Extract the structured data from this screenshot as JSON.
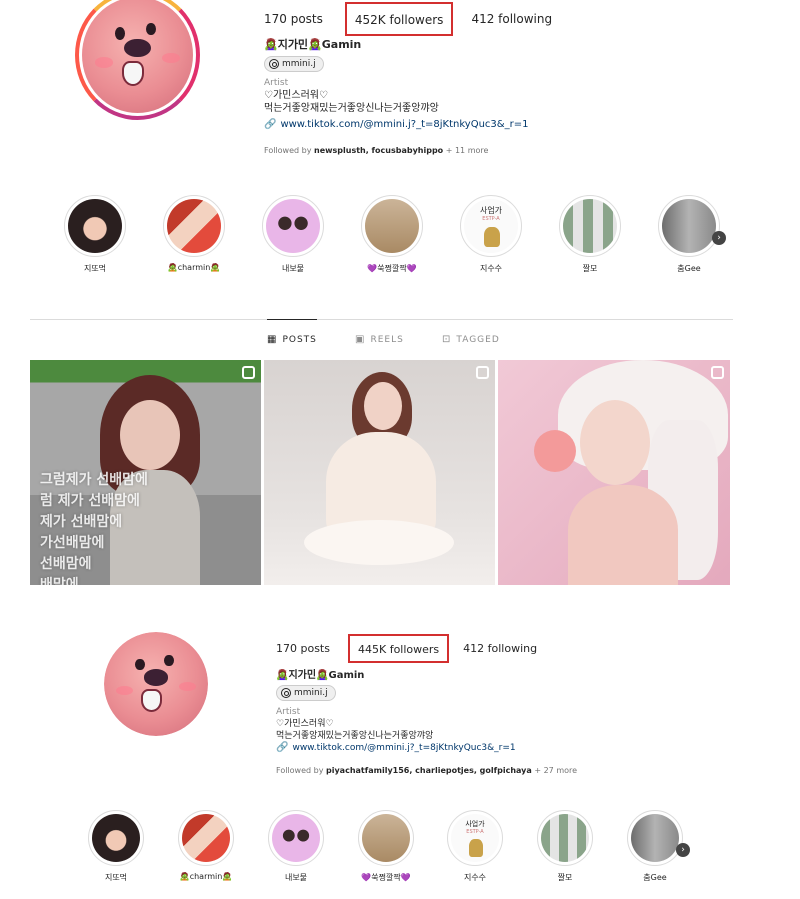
{
  "profile_top": {
    "stats": {
      "posts": "170 posts",
      "followers": "452K followers",
      "following": "412 following"
    },
    "name": "🧟‍♀️지가민🧟‍♀️Gamin",
    "threads_handle": "mmini.j",
    "category": "Artist",
    "bio_line1": "♡가민스러워♡",
    "bio_line2": "먹는거좋앙재밌는거좋앙신나는거좋앙꺄앙",
    "link": "www.tiktok.com/@mmini.j?_t=8jKtnkyQuc3&_r=1",
    "followed_by_prefix": "Followed by",
    "followed_by_names": "newsplusth, focusbabyhippo",
    "followed_by_more": "+ 11 more"
  },
  "profile_bottom": {
    "stats": {
      "posts": "170 posts",
      "followers": "445K followers",
      "following": "412 following"
    },
    "name": "🧟‍♀️지가민🧟‍♀️Gamin",
    "threads_handle": "mmini.j",
    "category": "Artist",
    "bio_line1": "♡가민스러워♡",
    "bio_line2": "먹는거좋앙재밌는거좋앙신나는거좋앙꺄앙",
    "link": "www.tiktok.com/@mmini.j?_t=8jKtnkyQuc3&_r=1",
    "followed_by_prefix": "Followed by",
    "followed_by_names": "piyachatfamily156, charliepotjes, golfpichaya",
    "followed_by_more": "+ 27 more"
  },
  "highlights_top": [
    {
      "label": "지또먹"
    },
    {
      "label": "🧟charmin🧟"
    },
    {
      "label": "내보물"
    },
    {
      "label": "💜쑥쩡깔짝💜"
    },
    {
      "label": "지수수",
      "cover_text": "사업가",
      "cover_sub": "ESTP-A"
    },
    {
      "label": "짤모"
    },
    {
      "label": "춤Gee"
    }
  ],
  "highlights_bottom": [
    {
      "label": "지또먹"
    },
    {
      "label": "🧟charmin🧟"
    },
    {
      "label": "내보물"
    },
    {
      "label": "💜쑥쩡깔짝💜"
    },
    {
      "label": "지수수",
      "cover_text": "사업가",
      "cover_sub": "ESTP-A"
    },
    {
      "label": "짤모"
    },
    {
      "label": "춤Gee"
    }
  ],
  "tabs": [
    {
      "icon": "grid-icon",
      "label": "POSTS"
    },
    {
      "icon": "reels-icon",
      "label": "REELS"
    },
    {
      "icon": "tagged-icon",
      "label": "TAGGED"
    }
  ],
  "posts": [
    {
      "type": "reel",
      "overlay_lines": [
        "그럼제가 선배맘에",
        "럼 제가 선배맘에",
        "제가 선배맘에",
        "가선배맘에",
        "선배맘에",
        "배맘에"
      ]
    },
    {
      "type": "carousel"
    },
    {
      "type": "carousel"
    }
  ],
  "colors": {
    "highlight_box": "#d32f2f",
    "link": "#00376b",
    "avatar_pink": "#ea8d93"
  }
}
